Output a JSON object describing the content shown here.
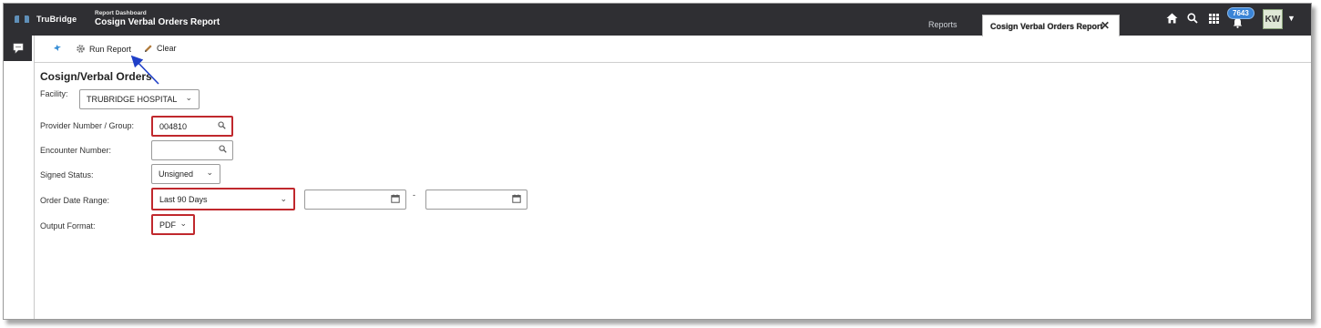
{
  "header": {
    "brand": "TruBridge",
    "breadcrumb_top": "Report Dashboard",
    "breadcrumb_title": "Cosign Verbal Orders Report",
    "tabs": [
      {
        "label": "Reports"
      },
      {
        "label": "Cosign Verbal Orders Report"
      }
    ],
    "notification_count": "7643",
    "user_initials": "KW"
  },
  "toolbar": {
    "run_report_label": "Run Report",
    "clear_label": "Clear"
  },
  "form": {
    "title": "Cosign/Verbal Orders",
    "facility": {
      "label": "Facility:",
      "value": "TRUBRIDGE HOSPITAL"
    },
    "provider": {
      "label": "Provider Number / Group:",
      "value": "004810"
    },
    "encounter": {
      "label": "Encounter Number:",
      "value": ""
    },
    "signed_status": {
      "label": "Signed Status:",
      "value": "Unsigned"
    },
    "order_date_range": {
      "label": "Order Date Range:",
      "value": "Last 90 Days",
      "range_separator": "-",
      "start_date": "",
      "end_date": ""
    },
    "output_format": {
      "label": "Output Format:",
      "value": "PDF"
    }
  },
  "colors": {
    "topbar": "#2f2f33",
    "required_border": "#c0282d",
    "badge": "#3a84d6",
    "annotation_arrow": "#1f3fc8"
  }
}
